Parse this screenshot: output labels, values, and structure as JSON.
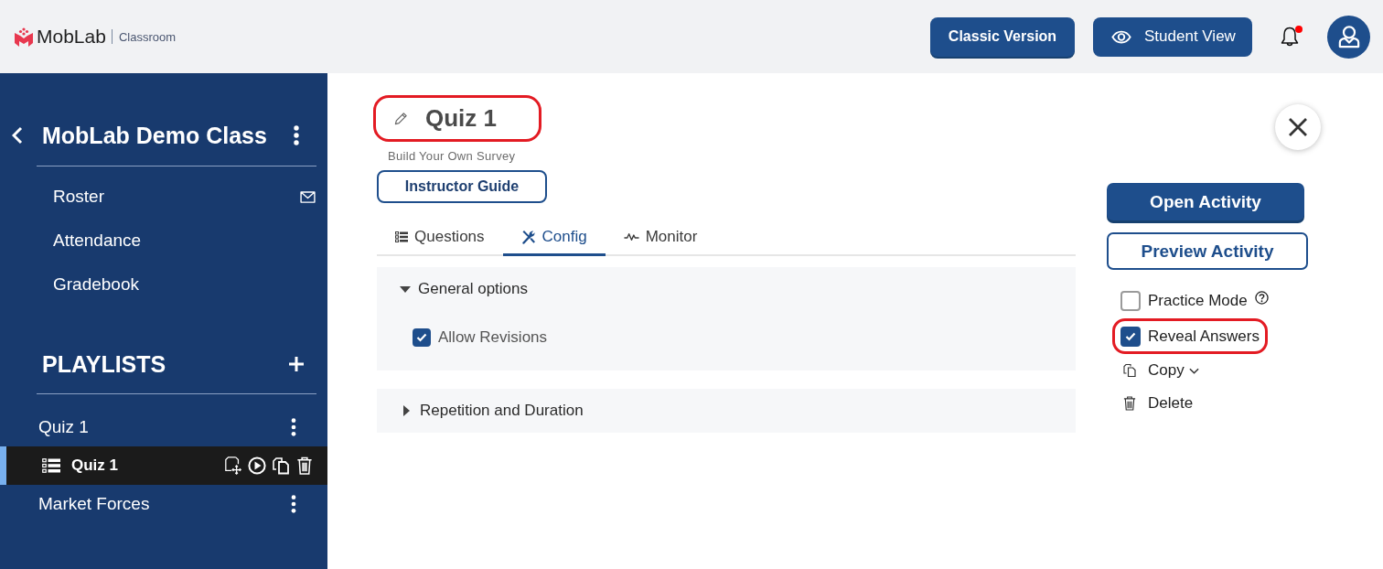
{
  "header": {
    "logo": {
      "brand": "MobLab",
      "product": "Classroom"
    },
    "buttons": [
      {
        "label": "Classic Version",
        "kind": "version"
      },
      {
        "label": "Student View",
        "kind": "preview"
      }
    ],
    "notifications": {
      "unread": true
    }
  },
  "sidebar": {
    "class_title": "MobLab Demo Class",
    "nav": [
      {
        "label": "Roster",
        "kind": "messaging"
      },
      {
        "label": "Attendance",
        "kind": "plain"
      },
      {
        "label": "Gradebook",
        "kind": "plain"
      }
    ],
    "playlists_heading": "PLAYLISTS",
    "playlists": [
      {
        "label": "Quiz 1",
        "selected": false,
        "children": [
          {
            "label": "Quiz 1",
            "selected": true
          }
        ]
      },
      {
        "label": "Market Forces",
        "selected": false
      }
    ]
  },
  "activity": {
    "title": "Quiz 1",
    "highlighted": true,
    "subtitle": "Build Your Own Survey",
    "guide_button": "Instructor Guide"
  },
  "tabs": [
    {
      "label": "Questions",
      "kind": "questions",
      "selected": false
    },
    {
      "label": "Config",
      "kind": "config",
      "selected": true
    },
    {
      "label": "Monitor",
      "kind": "monitor",
      "selected": false
    }
  ],
  "sections": [
    {
      "title": "General options",
      "expanded": true,
      "options": [
        {
          "label": "Allow Revisions",
          "checked": true
        }
      ]
    },
    {
      "title": "Repetition and Duration",
      "expanded": false
    }
  ],
  "actions": {
    "primary": "Open Activity",
    "secondary": "Preview Activity",
    "options": [
      {
        "label": "Practice Mode",
        "checked": false,
        "help": true,
        "highlighted": false
      },
      {
        "label": "Reveal Answers",
        "checked": true,
        "help": false,
        "highlighted": true
      }
    ],
    "links": [
      {
        "label": "Copy",
        "kind": "copy",
        "menu": true
      },
      {
        "label": "Delete",
        "kind": "delete",
        "menu": false
      }
    ]
  }
}
